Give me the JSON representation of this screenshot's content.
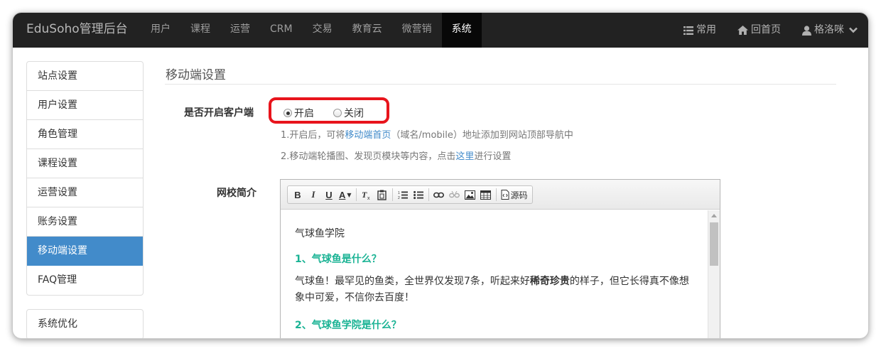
{
  "navbar": {
    "brand": "EduSoho管理后台",
    "items": [
      {
        "label": "用户"
      },
      {
        "label": "课程"
      },
      {
        "label": "运营"
      },
      {
        "label": "CRM"
      },
      {
        "label": "交易"
      },
      {
        "label": "教育云"
      },
      {
        "label": "微营销"
      },
      {
        "label": "系统",
        "active": true
      }
    ],
    "right": {
      "common": "常用",
      "home": "回首页",
      "user": "格洛咪"
    }
  },
  "sidebar": {
    "group1": [
      "站点设置",
      "用户设置",
      "角色管理",
      "课程设置",
      "运营设置",
      "账务设置",
      "移动端设置",
      "FAQ管理"
    ],
    "active_index": 6,
    "group2": [
      "系统优化"
    ]
  },
  "content": {
    "title": "移动端设置",
    "client_label": "是否开启客户端",
    "radio_on": "开启",
    "radio_off": "关闭",
    "selected": "开启",
    "help1_pre": "1.开启后，可将",
    "help1_link": "移动端首页",
    "help1_post": "（域名/mobile）地址添加到网站顶部导航中",
    "help2_pre": "2.移动端轮播图、发现页模块等内容，点击",
    "help2_link": "这里",
    "help2_post": "进行设置",
    "intro_label": "网校简介",
    "toolbar": {
      "bold": "B",
      "italic": "I",
      "underline": "U",
      "fontcolor": "A",
      "source": "源码"
    },
    "editor": {
      "p1": "气球鱼学院",
      "h1": "1、气球鱼是什么？",
      "p2_pre": "气球鱼！最罕见的鱼类，全世界仅发现7条，听起来好",
      "p2_bold": "稀奇珍贵",
      "p2_post": "的样子，但它长得真不像想",
      "p2_line2": "象中可爱，不信你去百度！",
      "h2": "2、气球鱼学院是什么？"
    }
  },
  "colors": {
    "navbar_bg": "#222222",
    "active_nav": "#080808",
    "sidebar_active": "#428bca",
    "link": "#428bca",
    "heading_green": "#1ab394",
    "highlight_red": "#e8141c"
  }
}
